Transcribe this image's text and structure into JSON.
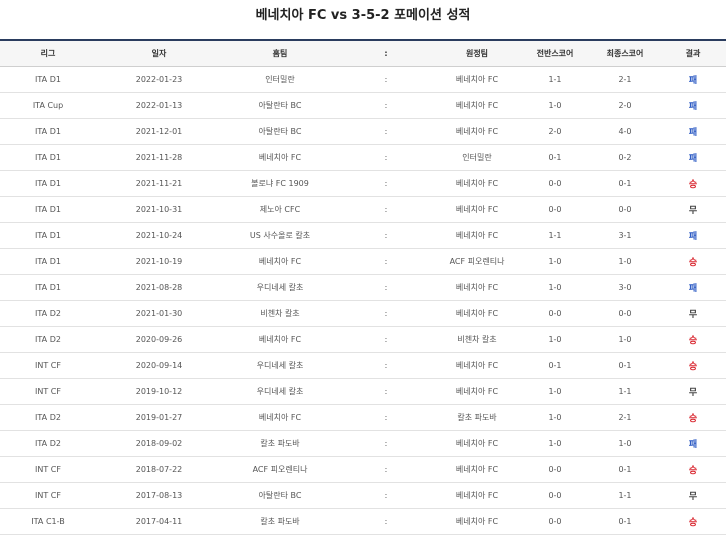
{
  "title": "베네치아 FC vs 3-5-2 포메이션 성적",
  "columns": [
    "리그",
    "일자",
    "홈팀",
    ":",
    "원정팀",
    "전반스코어",
    "최종스코어",
    "결과"
  ],
  "rows": [
    {
      "league": "ITA D1",
      "date": "2022-01-23",
      "home": "인터밀란",
      "sep": ":",
      "away": "베네치아 FC",
      "half": "1-1",
      "final": "2-1",
      "result": "패",
      "type": "loss"
    },
    {
      "league": "ITA Cup",
      "date": "2022-01-13",
      "home": "아탈란타 BC",
      "sep": ":",
      "away": "베네치아 FC",
      "half": "1-0",
      "final": "2-0",
      "result": "패",
      "type": "loss"
    },
    {
      "league": "ITA D1",
      "date": "2021-12-01",
      "home": "아탈란타 BC",
      "sep": ":",
      "away": "베네치아 FC",
      "half": "2-0",
      "final": "4-0",
      "result": "패",
      "type": "loss"
    },
    {
      "league": "ITA D1",
      "date": "2021-11-28",
      "home": "베네치아 FC",
      "sep": ":",
      "away": "인터밀란",
      "half": "0-1",
      "final": "0-2",
      "result": "패",
      "type": "loss"
    },
    {
      "league": "ITA D1",
      "date": "2021-11-21",
      "home": "볼로냐 FC 1909",
      "sep": ":",
      "away": "베네치아 FC",
      "half": "0-0",
      "final": "0-1",
      "result": "승",
      "type": "win"
    },
    {
      "league": "ITA D1",
      "date": "2021-10-31",
      "home": "제노아 CFC",
      "sep": ":",
      "away": "베네치아 FC",
      "half": "0-0",
      "final": "0-0",
      "result": "무",
      "type": "draw"
    },
    {
      "league": "ITA D1",
      "date": "2021-10-24",
      "home": "US 사수올로 칼초",
      "sep": ":",
      "away": "베네치아 FC",
      "half": "1-1",
      "final": "3-1",
      "result": "패",
      "type": "loss"
    },
    {
      "league": "ITA D1",
      "date": "2021-10-19",
      "home": "베네치아 FC",
      "sep": ":",
      "away": "ACF 피오렌티나",
      "half": "1-0",
      "final": "1-0",
      "result": "승",
      "type": "win"
    },
    {
      "league": "ITA D1",
      "date": "2021-08-28",
      "home": "우디네세 칼초",
      "sep": ":",
      "away": "베네치아 FC",
      "half": "1-0",
      "final": "3-0",
      "result": "패",
      "type": "loss"
    },
    {
      "league": "ITA D2",
      "date": "2021-01-30",
      "home": "비첸차 칼초",
      "sep": ":",
      "away": "베네치아 FC",
      "half": "0-0",
      "final": "0-0",
      "result": "무",
      "type": "draw"
    },
    {
      "league": "ITA D2",
      "date": "2020-09-26",
      "home": "베네치아 FC",
      "sep": ":",
      "away": "비첸차 칼초",
      "half": "1-0",
      "final": "1-0",
      "result": "승",
      "type": "win"
    },
    {
      "league": "INT CF",
      "date": "2020-09-14",
      "home": "우디네세 칼초",
      "sep": ":",
      "away": "베네치아 FC",
      "half": "0-1",
      "final": "0-1",
      "result": "승",
      "type": "win"
    },
    {
      "league": "INT CF",
      "date": "2019-10-12",
      "home": "우디네세 칼초",
      "sep": ":",
      "away": "베네치아 FC",
      "half": "1-0",
      "final": "1-1",
      "result": "무",
      "type": "draw"
    },
    {
      "league": "ITA D2",
      "date": "2019-01-27",
      "home": "베네치아 FC",
      "sep": ":",
      "away": "칼초 파도바",
      "half": "1-0",
      "final": "2-1",
      "result": "승",
      "type": "win"
    },
    {
      "league": "ITA D2",
      "date": "2018-09-02",
      "home": "칼초 파도바",
      "sep": ":",
      "away": "베네치아 FC",
      "half": "1-0",
      "final": "1-0",
      "result": "패",
      "type": "loss"
    },
    {
      "league": "INT CF",
      "date": "2018-07-22",
      "home": "ACF 피오렌티나",
      "sep": ":",
      "away": "베네치아 FC",
      "half": "0-0",
      "final": "0-1",
      "result": "승",
      "type": "win"
    },
    {
      "league": "INT CF",
      "date": "2017-08-13",
      "home": "아탈란타 BC",
      "sep": ":",
      "away": "베네치아 FC",
      "half": "0-0",
      "final": "1-1",
      "result": "무",
      "type": "draw"
    },
    {
      "league": "ITA C1-B",
      "date": "2017-04-11",
      "home": "칼초 파도바",
      "sep": ":",
      "away": "베네치아 FC",
      "half": "0-0",
      "final": "0-1",
      "result": "승",
      "type": "win"
    }
  ],
  "colors": {
    "win": "#d9262f",
    "loss": "#2b59c3",
    "draw": "#444444",
    "header_rule": "#2a3c5e"
  }
}
